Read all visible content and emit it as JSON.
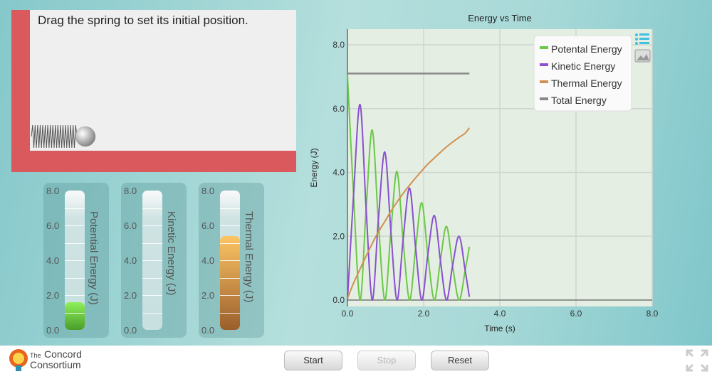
{
  "simulation": {
    "instruction": "Drag the spring to set its initial position."
  },
  "meters": [
    {
      "label": "Potential Energy (J)",
      "value": 1.6,
      "color_top": "#8ff05a",
      "color_bottom": "#4a9e2a"
    },
    {
      "label": "Kinetic Energy (J)",
      "value": 0,
      "color_top": "#a070e0",
      "color_bottom": "#7040c0"
    },
    {
      "label": "Thermal Energy (J)",
      "value": 5.4,
      "color_top": "#fcc564",
      "color_bottom": "#9a5e2c"
    }
  ],
  "meter_ticks": [
    "8.0",
    "6.0",
    "4.0",
    "2.0",
    "0.0"
  ],
  "controls": {
    "start": "Start",
    "stop": "Stop",
    "reset": "Reset"
  },
  "logo": {
    "line1_small": "The",
    "line1": "Concord",
    "line2": "Consortium"
  },
  "chart_data": {
    "type": "line",
    "title": "Energy vs Time",
    "xlabel": "Time (s)",
    "ylabel": "Energy (J)",
    "xlim": [
      0,
      8
    ],
    "ylim": [
      0,
      8
    ],
    "xticks": [
      "0.0",
      "2.0",
      "4.0",
      "6.0",
      "8.0"
    ],
    "yticks": [
      "0.0",
      "2.0",
      "4.0",
      "6.0",
      "8.0"
    ],
    "grid": true,
    "legend_placement": "top-right",
    "x": [
      0,
      0.16,
      0.33,
      0.49,
      0.65,
      0.81,
      0.98,
      1.14,
      1.3,
      1.46,
      1.63,
      1.79,
      1.95,
      2.11,
      2.28,
      2.44,
      2.6,
      2.76,
      2.93,
      3.09,
      3.2
    ],
    "series": [
      {
        "name": "Potental Energy",
        "color": "#6cc84a",
        "values": [
          7.05,
          3.29,
          0,
          2.86,
          5.33,
          2.49,
          0,
          2.16,
          4.03,
          1.88,
          0,
          1.63,
          3.05,
          1.42,
          0,
          1.24,
          2.31,
          1.08,
          0,
          0.93,
          1.67
        ]
      },
      {
        "name": "Kinetic Energy",
        "color": "#8a50d0",
        "values": [
          0,
          3.29,
          6.13,
          2.86,
          0,
          2.49,
          4.64,
          2.16,
          0,
          1.88,
          3.51,
          1.63,
          0,
          1.42,
          2.65,
          1.24,
          0,
          1.08,
          2.0,
          0.93,
          0.1
        ]
      },
      {
        "name": "Thermal Energy",
        "color": "#d09050",
        "values": [
          0.05,
          0.53,
          0.97,
          1.38,
          1.77,
          2.13,
          2.46,
          2.78,
          3.07,
          3.34,
          3.6,
          3.83,
          4.05,
          4.26,
          4.45,
          4.63,
          4.8,
          4.95,
          5.1,
          5.23,
          5.4
        ]
      },
      {
        "name": "Total Energy",
        "color": "#888888",
        "values": [
          7.1,
          7.1,
          7.1,
          7.1,
          7.1,
          7.1,
          7.1,
          7.1,
          7.1,
          7.1,
          7.1,
          7.1,
          7.1,
          7.1,
          7.1,
          7.1,
          7.1,
          7.1,
          7.1,
          7.1,
          7.1
        ]
      }
    ]
  }
}
